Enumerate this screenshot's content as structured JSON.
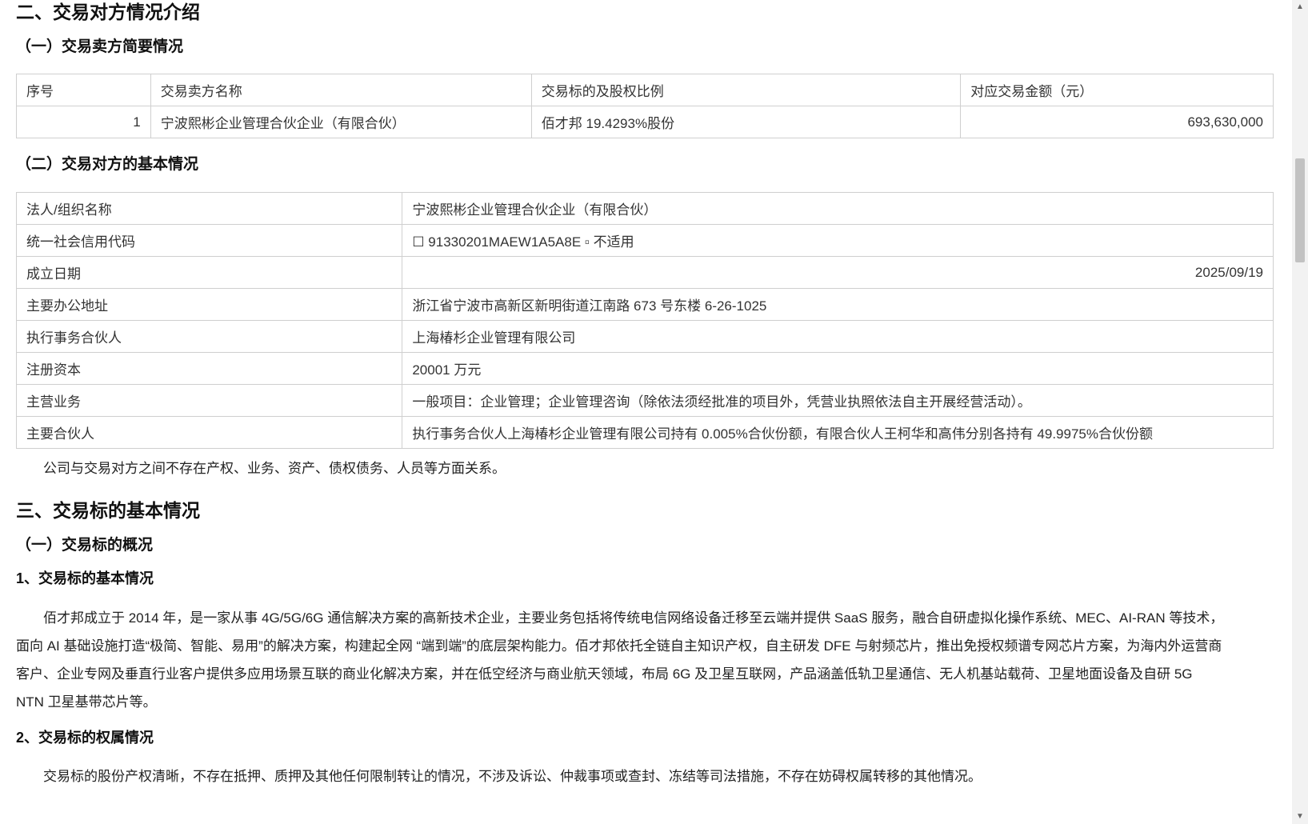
{
  "section2": {
    "title": "二、交易对方情况介绍",
    "sub1_title": "（一）交易卖方简要情况",
    "seller_table": {
      "headers": [
        "序号",
        "交易卖方名称",
        "交易标的及股权比例",
        "对应交易金额（元）"
      ],
      "row": {
        "index": "1",
        "name": "宁波熙彬企业管理合伙企业（有限合伙）",
        "target": "佰才邦 19.4293%股份",
        "amount": "693,630,000"
      }
    },
    "sub2_title": "（二）交易对方的基本情况",
    "info_table": [
      {
        "label": "法人/组织名称",
        "value": "宁波熙彬企业管理合伙企业（有限合伙）"
      },
      {
        "label": "统一社会信用代码",
        "value": "☐ 91330201MAEW1A5A8E ▫ 不适用"
      },
      {
        "label": "成立日期",
        "value": "2025/09/19"
      },
      {
        "label": "主要办公地址",
        "value": "浙江省宁波市高新区新明街道江南路 673 号东楼 6-26-1025"
      },
      {
        "label": "执行事务合伙人",
        "value": "上海椿杉企业管理有限公司"
      },
      {
        "label": "注册资本",
        "value": "20001 万元"
      },
      {
        "label": "主营业务",
        "value": "一般项目：企业管理；企业管理咨询（除依法须经批准的项目外，凭营业执照依法自主开展经营活动）。"
      },
      {
        "label": "主要合伙人",
        "value": "执行事务合伙人上海椿杉企业管理有限公司持有 0.005%合伙份额，有限合伙人王柯华和高伟分别各持有 49.9975%合伙份额"
      }
    ],
    "relation_note": "公司与交易对方之间不存在产权、业务、资产、债权债务、人员等方面关系。"
  },
  "section3": {
    "title": "三、交易标的基本情况",
    "sub1_title": "（一）交易标的概况",
    "item1_title": "1、交易标的基本情况",
    "item1_text": "佰才邦成立于 2014 年，是一家从事 4G/5G/6G 通信解决方案的高新技术企业，主要业务包括将传统电信网络设备迁移至云端并提供 SaaS 服务，融合自研虚拟化操作系统、MEC、AI-RAN 等技术，面向 AI 基础设施打造“极简、智能、易用”的解决方案，构建起全网 “端到端”的底层架构能力。佰才邦依托全链自主知识产权，自主研发 DFE 与射频芯片，推出免授权频谱专网芯片方案，为海内外运营商客户、企业专网及垂直行业客户提供多应用场景互联的商业化解决方案，并在低空经济与商业航天领域，布局 6G 及卫星互联网，产品涵盖低轨卫星通信、无人机基站载荷、卫星地面设备及自研 5G NTN 卫星基带芯片等。",
    "item2_title": "2、交易标的权属情况",
    "item2_text": "交易标的股份产权清晰，不存在抵押、质押及其他任何限制转让的情况，不涉及诉讼、仲裁事项或查封、冻结等司法措施，不存在妨碍权属转移的其他情况。"
  },
  "scrollbar": {
    "up_arrow": "▲",
    "down_arrow": "▼"
  }
}
